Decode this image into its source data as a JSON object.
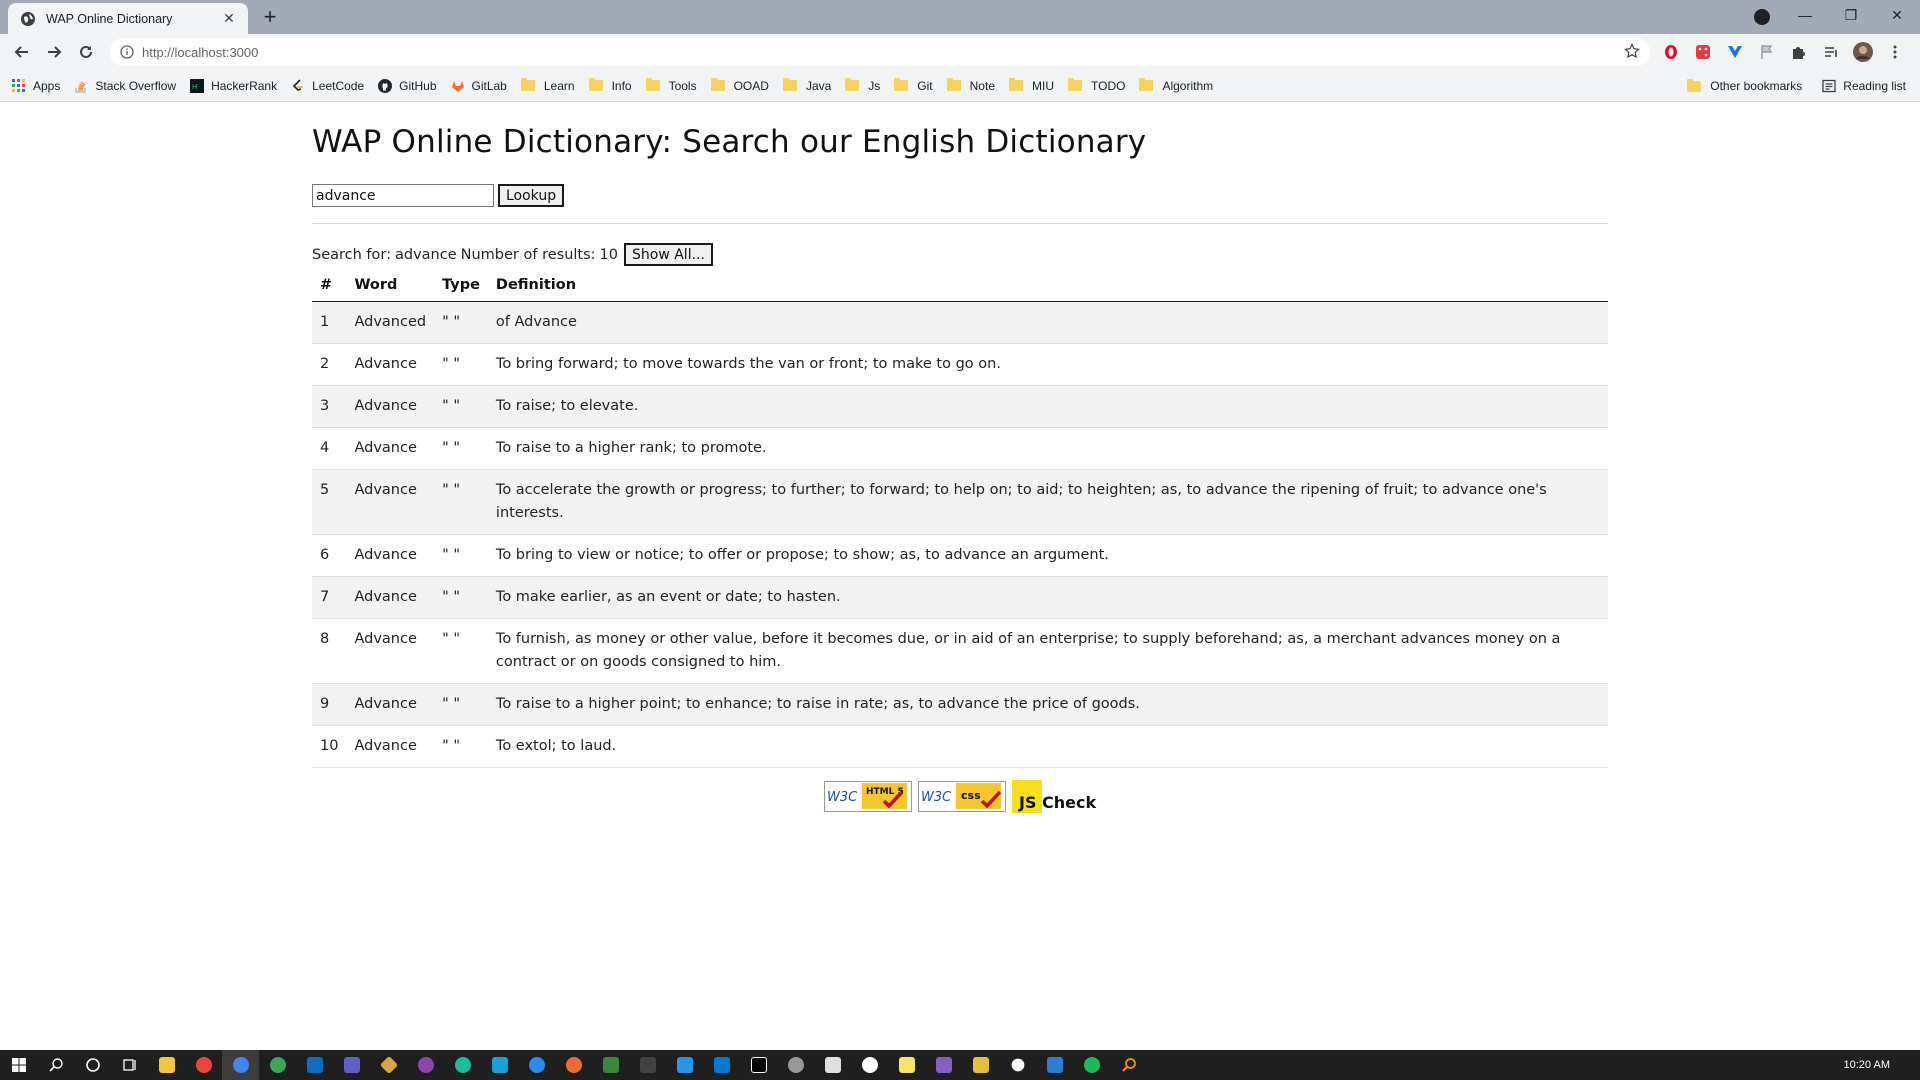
{
  "browser": {
    "tab_title": "WAP Online Dictionary",
    "tab_close": "✕",
    "new_tab": "+",
    "url": "http://localhost:3000",
    "window_controls": [
      "—",
      "❐",
      "✕"
    ]
  },
  "bookmarks": {
    "items": [
      {
        "label": "Apps",
        "icon": "apps-grid-icon"
      },
      {
        "label": "Stack Overflow",
        "icon": "stackoverflow-icon"
      },
      {
        "label": "HackerRank",
        "icon": "hackerrank-icon"
      },
      {
        "label": "LeetCode",
        "icon": "leetcode-icon"
      },
      {
        "label": "GitHub",
        "icon": "github-icon"
      },
      {
        "label": "GitLab",
        "icon": "gitlab-icon"
      },
      {
        "label": "Learn",
        "icon": "folder-icon"
      },
      {
        "label": "Info",
        "icon": "folder-icon"
      },
      {
        "label": "Tools",
        "icon": "folder-icon"
      },
      {
        "label": "OOAD",
        "icon": "folder-icon"
      },
      {
        "label": "Java",
        "icon": "folder-icon"
      },
      {
        "label": "Js",
        "icon": "folder-icon"
      },
      {
        "label": "Git",
        "icon": "folder-icon"
      },
      {
        "label": "Note",
        "icon": "folder-icon"
      },
      {
        "label": "MIU",
        "icon": "folder-icon"
      },
      {
        "label": "TODO",
        "icon": "folder-icon"
      },
      {
        "label": "Algorithm",
        "icon": "folder-icon"
      }
    ],
    "other_bookmarks": "Other bookmarks",
    "reading_list": "Reading list"
  },
  "page": {
    "title": "WAP Online Dictionary: Search our English Dictionary",
    "search": {
      "value": "advance",
      "button": "Lookup"
    },
    "results": {
      "search_for_label": "Search for:",
      "search_term": "advance",
      "count_label": "Number of results:",
      "count": "10",
      "show_all": "Show All..."
    },
    "table": {
      "headers": [
        "#",
        "Word",
        "Type",
        "Definition"
      ],
      "rows": [
        {
          "n": "1",
          "word": "Advanced",
          "type": "\" \"",
          "def": "of Advance"
        },
        {
          "n": "2",
          "word": "Advance",
          "type": "\" \"",
          "def": "To bring forward; to move towards the van or front; to make to go on."
        },
        {
          "n": "3",
          "word": "Advance",
          "type": "\" \"",
          "def": "To raise; to elevate."
        },
        {
          "n": "4",
          "word": "Advance",
          "type": "\" \"",
          "def": "To raise to a higher rank; to promote."
        },
        {
          "n": "5",
          "word": "Advance",
          "type": "\" \"",
          "def": "To accelerate the growth or progress; to further; to forward; to help on; to aid; to heighten; as, to advance the ripening of fruit; to advance one's interests."
        },
        {
          "n": "6",
          "word": "Advance",
          "type": "\" \"",
          "def": "To bring to view or notice; to offer or propose; to show; as, to advance an argument."
        },
        {
          "n": "7",
          "word": "Advance",
          "type": "\" \"",
          "def": "To make earlier, as an event or date; to hasten."
        },
        {
          "n": "8",
          "word": "Advance",
          "type": "\" \"",
          "def": "To furnish, as money or other value, before it becomes due, or in aid of an enterprise; to supply beforehand; as, a merchant advances money on a contract or on goods consigned to him."
        },
        {
          "n": "9",
          "word": "Advance",
          "type": "\" \"",
          "def": "To raise to a higher point; to enhance; to raise in rate; as, to advance the price of goods."
        },
        {
          "n": "10",
          "word": "Advance",
          "type": "\" \"",
          "def": "To extol; to laud."
        }
      ]
    },
    "badges": {
      "w3c": "W3C",
      "html5": "HTML 5",
      "css": "css",
      "js": "JS",
      "check": "Check"
    }
  },
  "taskbar": {
    "time": "10:20 AM"
  },
  "colors": {
    "tabstrip": "#a3aab7",
    "toolbar": "#f1f3f4",
    "row_stripe": "#f2f2f2",
    "taskbar": "#1f1f1f",
    "js_yellow": "#f7df1e"
  }
}
